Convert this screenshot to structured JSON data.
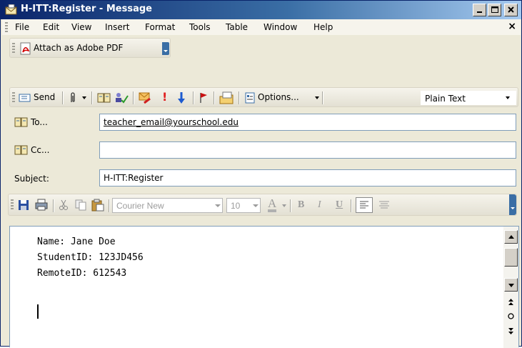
{
  "window": {
    "title": "H-ITT:Register - Message"
  },
  "menu": {
    "items": [
      "File",
      "Edit",
      "View",
      "Insert",
      "Format",
      "Tools",
      "Table",
      "Window",
      "Help"
    ]
  },
  "pdf_toolbar": {
    "attach_label": "Attach as Adobe PDF"
  },
  "send_toolbar": {
    "send_label": "Send",
    "options_label": "Options...",
    "format_value": "Plain Text"
  },
  "header": {
    "to_label": "To...",
    "to_value": "teacher_email@yourschool.edu",
    "cc_label": "Cc...",
    "cc_value": "",
    "subject_label": "Subject:",
    "subject_value": "H-ITT:Register"
  },
  "format_toolbar": {
    "font_value": "Courier New",
    "size_value": "10",
    "bold": "B",
    "italic": "I",
    "underline": "U",
    "font_color_letter": "A"
  },
  "message_body": {
    "lines": [
      "Name: Jane Doe",
      "StudentID: 123JD456",
      "RemoteID: 612543"
    ]
  },
  "colors": {
    "title_start": "#0A246A",
    "title_end": "#A6CAF0",
    "chrome": "#ECE9D8"
  }
}
